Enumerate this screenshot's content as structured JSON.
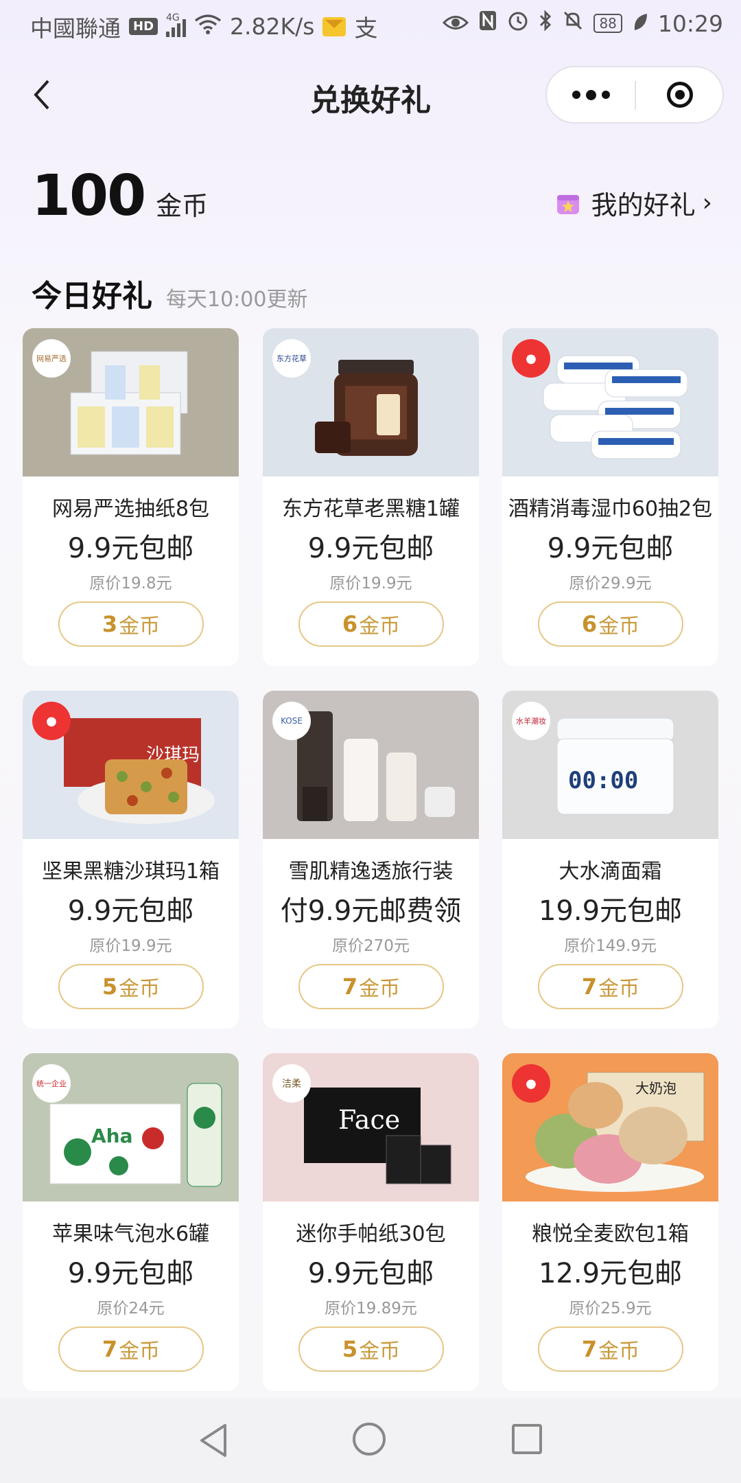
{
  "status_bar": {
    "carrier": "中國聯通",
    "hd": "HD",
    "network": "4G",
    "speed": "2.82K/s",
    "battery": "88",
    "time": "10:29"
  },
  "nav": {
    "title": "兑换好礼"
  },
  "coins": {
    "amount": "100",
    "unit": "金币",
    "my_gifts_label": "我的好礼"
  },
  "section": {
    "title": "今日好礼",
    "subtitle": "每天10:00更新"
  },
  "products": [
    {
      "name": "网易严选抽纸8包",
      "price": "9.9元包邮",
      "original": "原价19.8元",
      "coins": "3",
      "coin_unit": "金币",
      "logo": "网易严选",
      "bg": "#b3ae9e"
    },
    {
      "name": "东方花草老黑糖1罐",
      "price": "9.9元包邮",
      "original": "原价19.9元",
      "coins": "6",
      "coin_unit": "金币",
      "logo": "东方花草",
      "bg": "#dde3ea"
    },
    {
      "name": "酒精消毒湿巾60抽2包",
      "price": "9.9元包邮",
      "original": "原价29.9元",
      "coins": "6",
      "coin_unit": "金币",
      "logo": "",
      "bg": "#dfe5ec"
    },
    {
      "name": "坚果黑糖沙琪玛1箱",
      "price": "9.9元包邮",
      "original": "原价19.9元",
      "coins": "5",
      "coin_unit": "金币",
      "logo": "",
      "bg": "#dfe6ef"
    },
    {
      "name": "雪肌精逸透旅行装",
      "price": "付9.9元邮费领",
      "original": "原价270元",
      "coins": "7",
      "coin_unit": "金币",
      "logo": "KOSE",
      "bg": "#c7c2c0"
    },
    {
      "name": "大水滴面霜",
      "price": "19.9元包邮",
      "original": "原价149.9元",
      "coins": "7",
      "coin_unit": "金币",
      "logo": "水羊潮妆",
      "bg": "#dcdcdc"
    },
    {
      "name": "苹果味气泡水6罐",
      "price": "9.9元包邮",
      "original": "原价24元",
      "coins": "7",
      "coin_unit": "金币",
      "logo": "统一企业",
      "bg": "#bfc8b4"
    },
    {
      "name": "迷你手帕纸30包",
      "price": "9.9元包邮",
      "original": "原价19.89元",
      "coins": "5",
      "coin_unit": "金币",
      "logo": "洁柔",
      "bg": "#eed7d7"
    },
    {
      "name": "粮悦全麦欧包1箱",
      "price": "12.9元包邮",
      "original": "原价25.9元",
      "coins": "7",
      "coin_unit": "金币",
      "logo": "",
      "bg": "#f39a55"
    }
  ],
  "art_text": {
    "p4_box": "沙琪玛",
    "p6_jar": "00:00",
    "p7_can": "Aha",
    "p8_box": "Face",
    "p9_box": "大奶泡"
  }
}
